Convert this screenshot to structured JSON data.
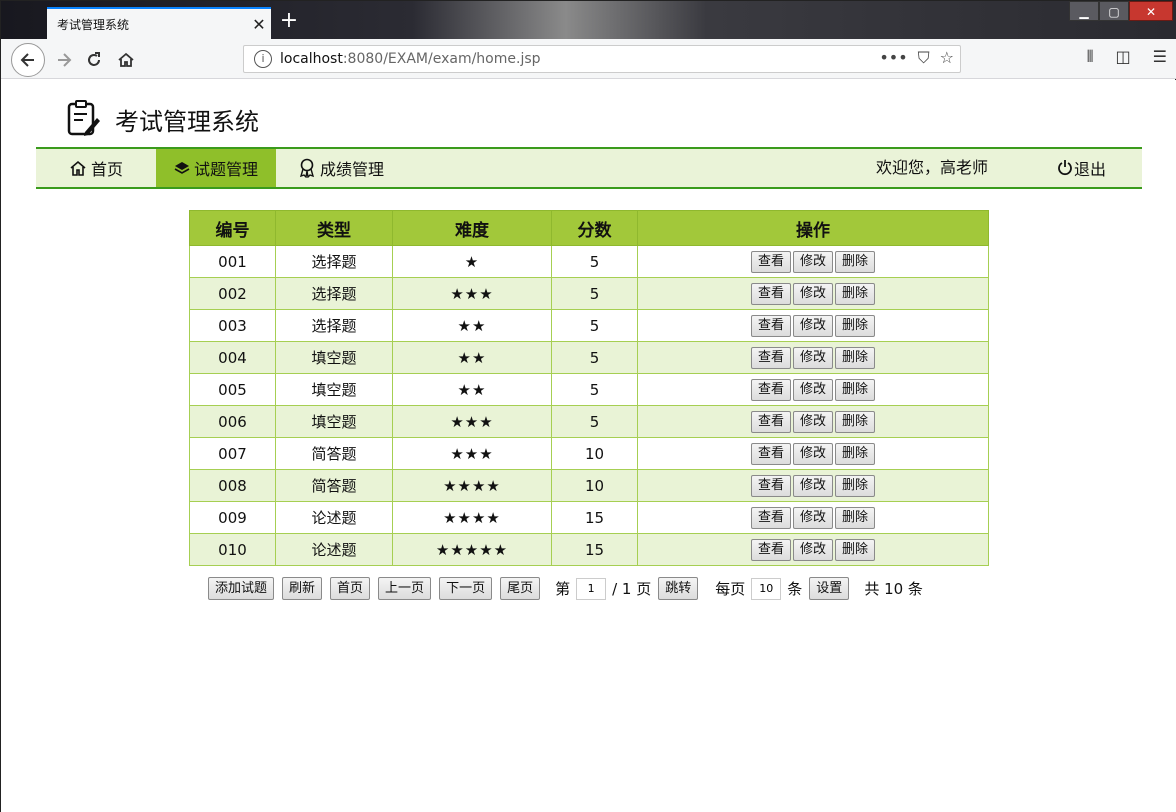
{
  "browser": {
    "tab_title": "考试管理系统",
    "tab_close": "✕",
    "new_tab": "+",
    "url_host": "localhost",
    "url_rest": ":8080/EXAM/exam/home.jsp",
    "url_actions": [
      "•••",
      "⛉",
      "☆"
    ]
  },
  "app": {
    "title": "考试管理系统"
  },
  "menu": {
    "home": "首页",
    "questions": "试题管理",
    "scores": "成绩管理",
    "welcome": "欢迎您，高老师",
    "logout": "退出"
  },
  "table": {
    "headers": [
      "编号",
      "类型",
      "难度",
      "分数",
      "操作"
    ],
    "rows": [
      {
        "id": "001",
        "type": "选择题",
        "difficulty": "★",
        "score": "5"
      },
      {
        "id": "002",
        "type": "选择题",
        "difficulty": "★★★",
        "score": "5"
      },
      {
        "id": "003",
        "type": "选择题",
        "difficulty": "★★",
        "score": "5"
      },
      {
        "id": "004",
        "type": "填空题",
        "difficulty": "★★",
        "score": "5"
      },
      {
        "id": "005",
        "type": "填空题",
        "difficulty": "★★",
        "score": "5"
      },
      {
        "id": "006",
        "type": "填空题",
        "difficulty": "★★★",
        "score": "5"
      },
      {
        "id": "007",
        "type": "简答题",
        "difficulty": "★★★",
        "score": "10"
      },
      {
        "id": "008",
        "type": "简答题",
        "difficulty": "★★★★",
        "score": "10"
      },
      {
        "id": "009",
        "type": "论述题",
        "difficulty": "★★★★",
        "score": "15"
      },
      {
        "id": "010",
        "type": "论述题",
        "difficulty": "★★★★★",
        "score": "15"
      }
    ],
    "actions": {
      "view": "查看",
      "edit": "修改",
      "delete": "删除"
    }
  },
  "pager": {
    "add": "添加试题",
    "refresh": "刷新",
    "first": "首页",
    "prev": "上一页",
    "next": "下一页",
    "last": "尾页",
    "page_label": "第",
    "page_value": "1",
    "page_total": "/ 1 页",
    "jump": "跳转",
    "per_page_label": "每页",
    "per_page_value": "10",
    "per_page_unit": "条",
    "set": "设置",
    "total": "共 10 条"
  }
}
